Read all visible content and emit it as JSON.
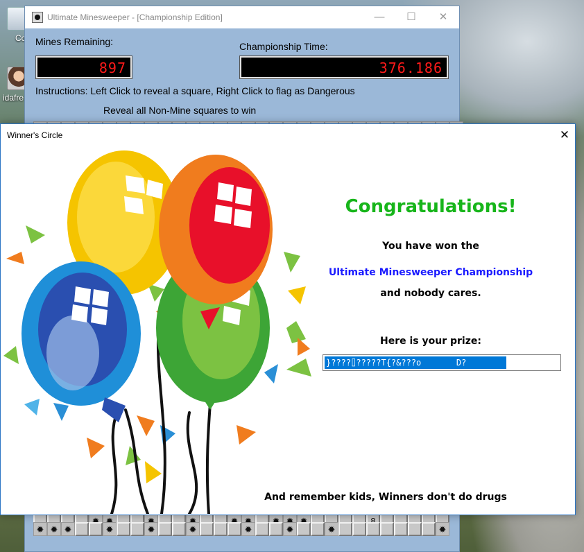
{
  "desktop": {
    "icons": [
      {
        "label": "Co",
        "name": "recycle-bin"
      },
      {
        "label": "idafre",
        "name": "user-folder"
      }
    ]
  },
  "minesweeper": {
    "title": "Ultimate Minesweeper - [Championship Edition]",
    "controls": {
      "minimize": "—",
      "maximize": "☐",
      "close": "✕"
    },
    "mines_label": "Mines Remaining:",
    "mines_value": "897",
    "time_label": "Championship Time:",
    "time_value": "376.186",
    "instructions": "Instructions: Left Click to reveal a square, Right Click to flag as Dangerous",
    "goal": "Reveal all Non-Mine squares to win",
    "mine_glyph": "✹",
    "visible_row_numbers": {
      "digit": "8"
    }
  },
  "dialog": {
    "title": "Winner's Circle",
    "close": "✕",
    "congrats": "Congratulations!",
    "won_line": "You have won the",
    "championship": "Ultimate Minesweeper Championship",
    "cares_line": "and nobody cares.",
    "prize_label": "Here is your prize:",
    "prize_value": "}????⌷?????T{?&???o       D?",
    "drugs_line": "And remember kids, Winners don't do drugs",
    "colors": {
      "congrats": "#17b51a",
      "championship": "#1a1aff",
      "selection": "#0078d7"
    }
  }
}
